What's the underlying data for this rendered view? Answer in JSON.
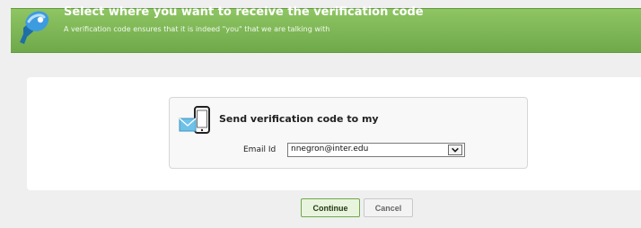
{
  "header": {
    "title": "Select where you want to receive the verification code",
    "subtitle": "A verification code ensures that it is indeed \"you\" that we are talking with",
    "icon": "key-icon",
    "background_color": "#7ab756"
  },
  "form": {
    "heading": "Send verification code to my",
    "heading_icon": "phone-mail-icon",
    "email_label": "Email Id",
    "email_selected": "nnegron@inter.edu"
  },
  "buttons": {
    "continue_label": "Continue",
    "cancel_label": "Cancel"
  }
}
